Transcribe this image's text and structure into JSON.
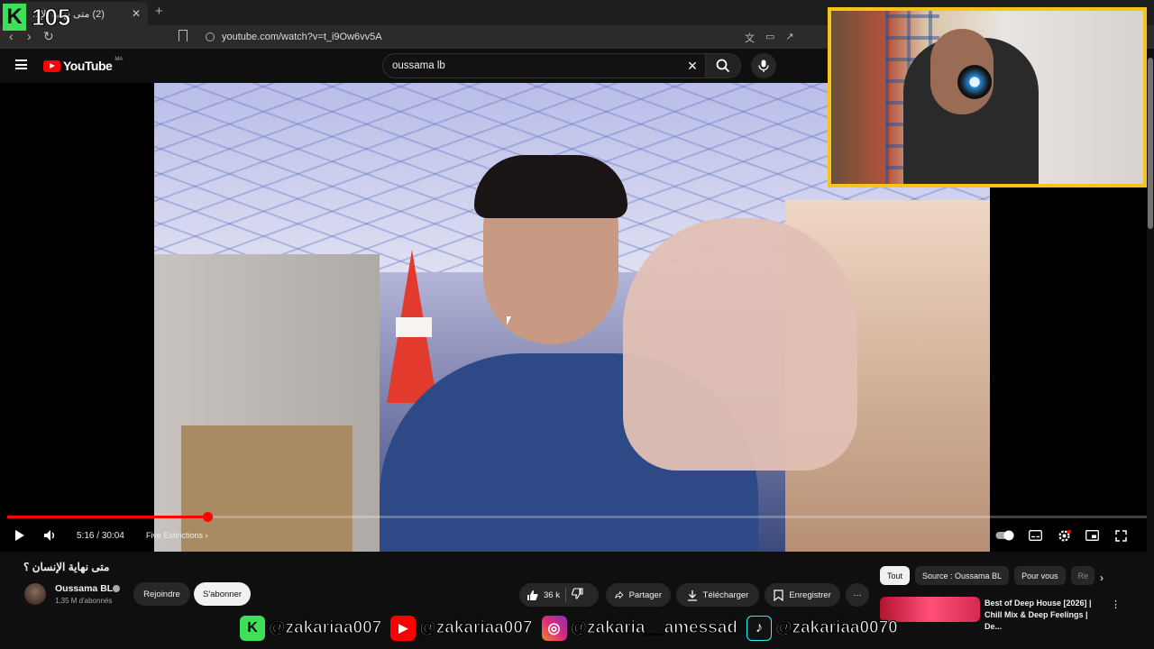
{
  "browser": {
    "tab_title": "(2) متى نهاية الإ...",
    "new_tab": "+",
    "tab_close": "✕",
    "url": "youtube.com/watch?v=t_i9Ow6vv5A"
  },
  "overlay": {
    "k_letter": "K",
    "k_count": "105"
  },
  "header": {
    "logo_text": "YouTube",
    "country_code": "MA",
    "search_value": "oussama lb"
  },
  "player": {
    "progress_fraction": 0.1756,
    "current_time": "5:16",
    "time_sep": " / ",
    "duration": "30:04",
    "chapter": "Five Extinctions",
    "chapter_arrow": "›"
  },
  "video": {
    "title": "متى نهاية الإنسان ؟",
    "channel": "Oussama BL",
    "subscribers": "1,35 M d'abonnés",
    "join_label": "Rejoindre",
    "subscribe_label": "S'abonner",
    "like_count": "36 k",
    "share_label": "Partager",
    "download_label": "Télécharger",
    "save_label": "Enregistrer",
    "more_label": "···"
  },
  "sidebar": {
    "chips": [
      "Tout",
      "Source : Oussama BL",
      "Pour vous",
      "Re"
    ],
    "next_label": "›",
    "rec_title": "Best of Deep House [2026] | Chill Mix & Deep Feelings | De...",
    "rec_more": "⋮"
  },
  "socials": [
    {
      "icon": "kick-icon",
      "icon_text": "K",
      "icon_color": "#3ee05a",
      "handle": "@zakariaa007"
    },
    {
      "icon": "youtube-icon",
      "icon_text": "▶",
      "icon_color": "#ff0000",
      "handle": "@zakariaa007"
    },
    {
      "icon": "instagram-icon",
      "icon_text": "◎",
      "icon_color": "#d6249f",
      "handle": "@zakaria__amessad"
    },
    {
      "icon": "tiktok-icon",
      "icon_text": "♪",
      "icon_color": "#111111",
      "handle": "@zakariaa0070"
    }
  ],
  "colors": {
    "accent": "#ff0000",
    "background": "#0f0f0f",
    "webcam_frame": "#f7c51a"
  }
}
